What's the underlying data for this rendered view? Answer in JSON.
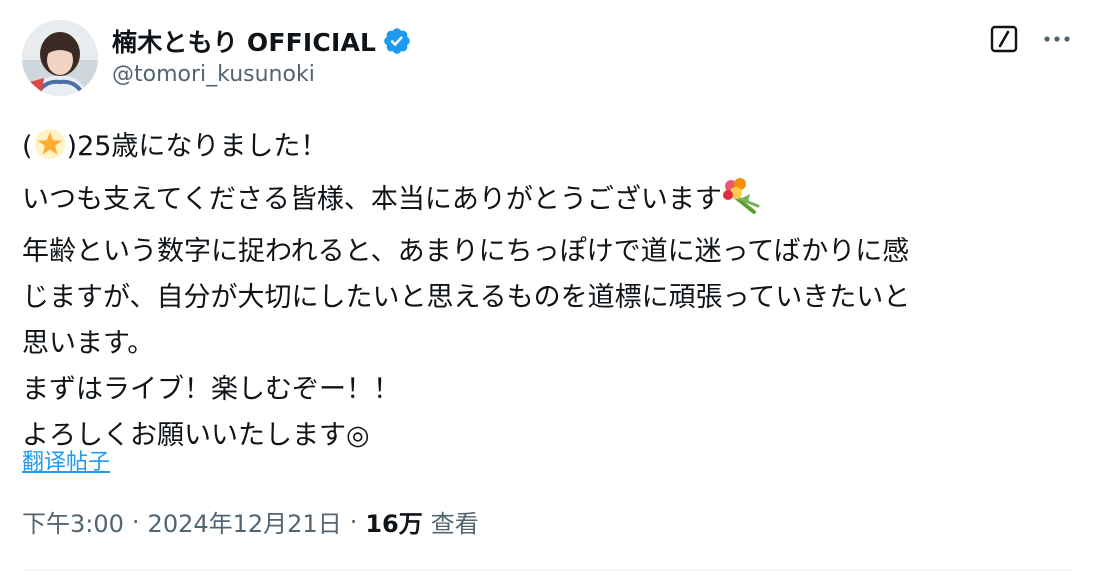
{
  "author": {
    "display_name": "楠木ともり OFFICIAL",
    "handle": "@tomori_kusunoki",
    "verified_icon": "verified-badge-icon",
    "avatar_icon": "avatar-photo"
  },
  "actions": {
    "grok_icon": "grok-icon",
    "more_icon": "more-options-icon"
  },
  "tweet": {
    "line1_open": "(",
    "line1_rest": ")25歳になりました！",
    "line2_text": "いつも支えてくださる皆様、本当にありがとうございます",
    "line3": "年齢という数字に捉われると、あまりにちっぽけで道に迷ってばかりに感",
    "line4": "じますが、自分が大切にしたいと思えるものを道標に頑張っていきたいと",
    "line5": "思います。",
    "line6": "まずはライブ！楽しむぞー！！",
    "line7": "よろしくお願いいたします◎",
    "emoji_star": "star-emoji-icon",
    "emoji_bouquet": "bouquet-emoji-icon"
  },
  "translate_label": "翻译帖子",
  "meta": {
    "time": "下午3:00",
    "separator": "·",
    "date": "2024年12月21日",
    "views_count": "16万",
    "views_label": "查看"
  },
  "colors": {
    "accent": "#1d9bf0",
    "secondary_text": "#536471",
    "primary_text": "#0f1419"
  }
}
